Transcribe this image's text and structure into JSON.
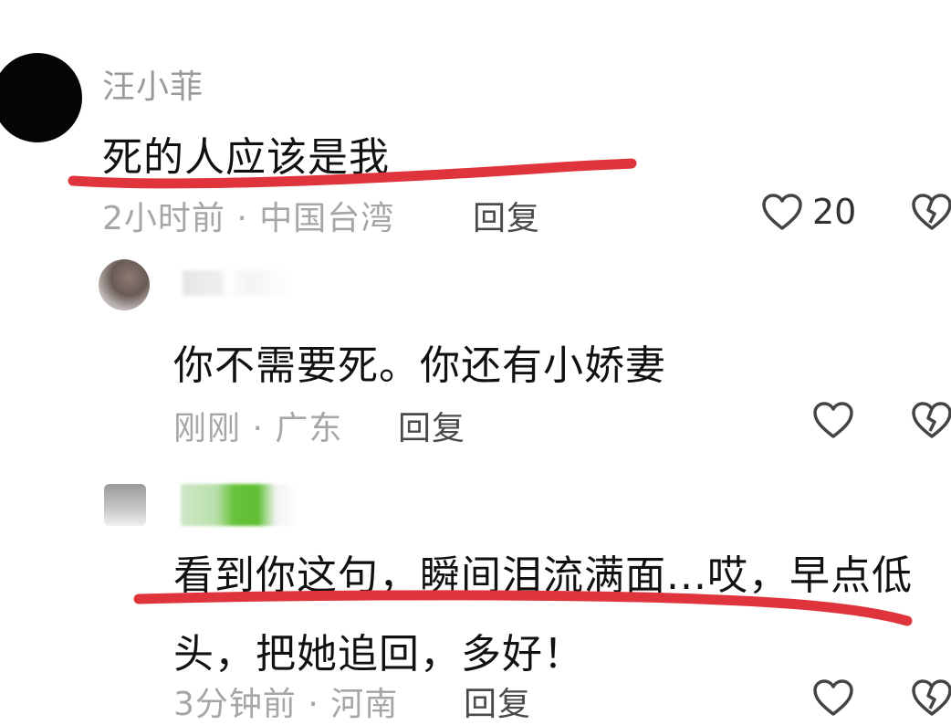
{
  "comment": {
    "username": "汪小菲",
    "text": "死的人应该是我",
    "meta": "2小时前 · 中国台湾",
    "reply_label": "回复",
    "likes": "20",
    "icons": [
      "heart-icon",
      "broken-heart-icon"
    ]
  },
  "replies": [
    {
      "text": "你不需要死。你还有小娇妻",
      "meta": "刚刚 · 广东",
      "reply_label": "回复"
    },
    {
      "text_line1": "看到你这句，瞬间泪流满面...哎，早点低",
      "text_line2": "头，把她追回，多好！",
      "meta": "3分钟前 · 河南",
      "reply_label": "回复"
    }
  ],
  "colors": {
    "underline": "#e0343c",
    "meta_text": "#a6a6a6",
    "main_text": "#111111"
  }
}
